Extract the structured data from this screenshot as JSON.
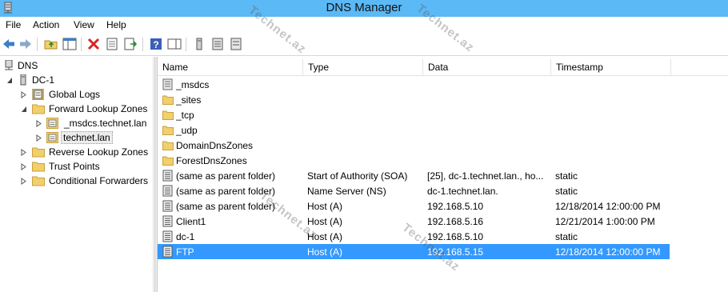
{
  "window": {
    "title": "DNS Manager"
  },
  "menu": [
    "File",
    "Action",
    "View",
    "Help"
  ],
  "tree": {
    "root": "DNS",
    "server": "DC-1",
    "items": [
      {
        "label": "Global Logs"
      },
      {
        "label": "Forward Lookup Zones"
      },
      {
        "label": "_msdcs.technet.lan"
      },
      {
        "label": "technet.lan"
      },
      {
        "label": "Reverse Lookup Zones"
      },
      {
        "label": "Trust Points"
      },
      {
        "label": "Conditional Forwarders"
      }
    ]
  },
  "list": {
    "columns": [
      "Name",
      "Type",
      "Data",
      "Timestamp"
    ],
    "rows": [
      {
        "name": "_msdcs",
        "type": "",
        "data": "",
        "timestamp": ""
      },
      {
        "name": "_sites",
        "type": "",
        "data": "",
        "timestamp": ""
      },
      {
        "name": "_tcp",
        "type": "",
        "data": "",
        "timestamp": ""
      },
      {
        "name": "_udp",
        "type": "",
        "data": "",
        "timestamp": ""
      },
      {
        "name": "DomainDnsZones",
        "type": "",
        "data": "",
        "timestamp": ""
      },
      {
        "name": "ForestDnsZones",
        "type": "",
        "data": "",
        "timestamp": ""
      },
      {
        "name": "(same as parent folder)",
        "type": "Start of Authority (SOA)",
        "data": "[25], dc-1.technet.lan., ho...",
        "timestamp": "static"
      },
      {
        "name": "(same as parent folder)",
        "type": "Name Server (NS)",
        "data": "dc-1.technet.lan.",
        "timestamp": "static"
      },
      {
        "name": "(same as parent folder)",
        "type": "Host (A)",
        "data": "192.168.5.10",
        "timestamp": "12/18/2014 12:00:00 PM"
      },
      {
        "name": "Client1",
        "type": "Host (A)",
        "data": "192.168.5.16",
        "timestamp": "12/21/2014 1:00:00 PM"
      },
      {
        "name": "dc-1",
        "type": "Host (A)",
        "data": "192.168.5.10",
        "timestamp": "static"
      },
      {
        "name": "FTP",
        "type": "Host (A)",
        "data": "192.168.5.15",
        "timestamp": "12/18/2014 12:00:00 PM"
      }
    ]
  },
  "watermark": "Technet.az",
  "colors": {
    "titlebar": "#5bb9f5",
    "selection": "#3399ff",
    "folder": "#f2cf6d"
  }
}
